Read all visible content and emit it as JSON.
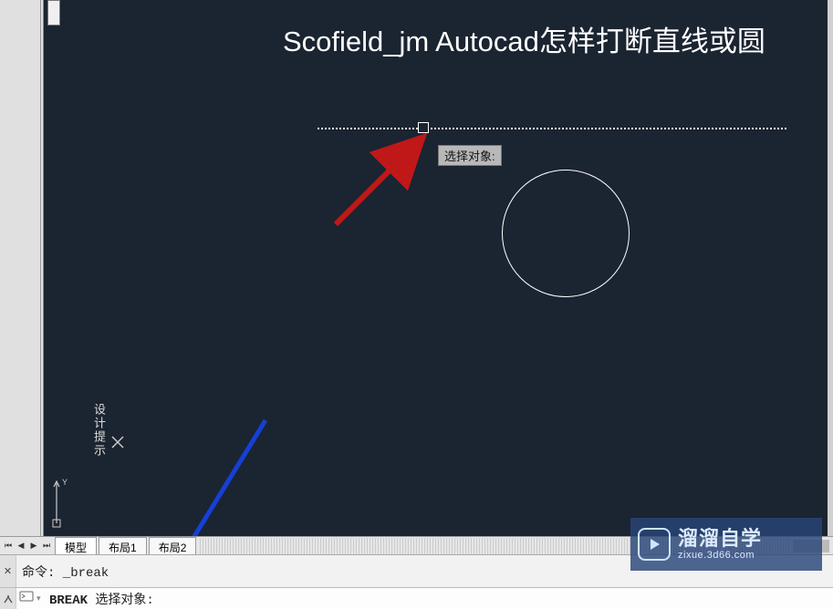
{
  "title_text": "Scofield_jm Autocad怎样打断直线或圆",
  "tooltip": "选择对象:",
  "side_label": "设计提示",
  "tabs": {
    "model": "模型",
    "layout1": "布局1",
    "layout2": "布局2"
  },
  "command": {
    "history": "命令: _break",
    "prompt_kw": "BREAK",
    "prompt_rest": " 选择对象:"
  },
  "watermark": {
    "brand": "溜溜自学",
    "url": "zixue.3d66.com"
  }
}
